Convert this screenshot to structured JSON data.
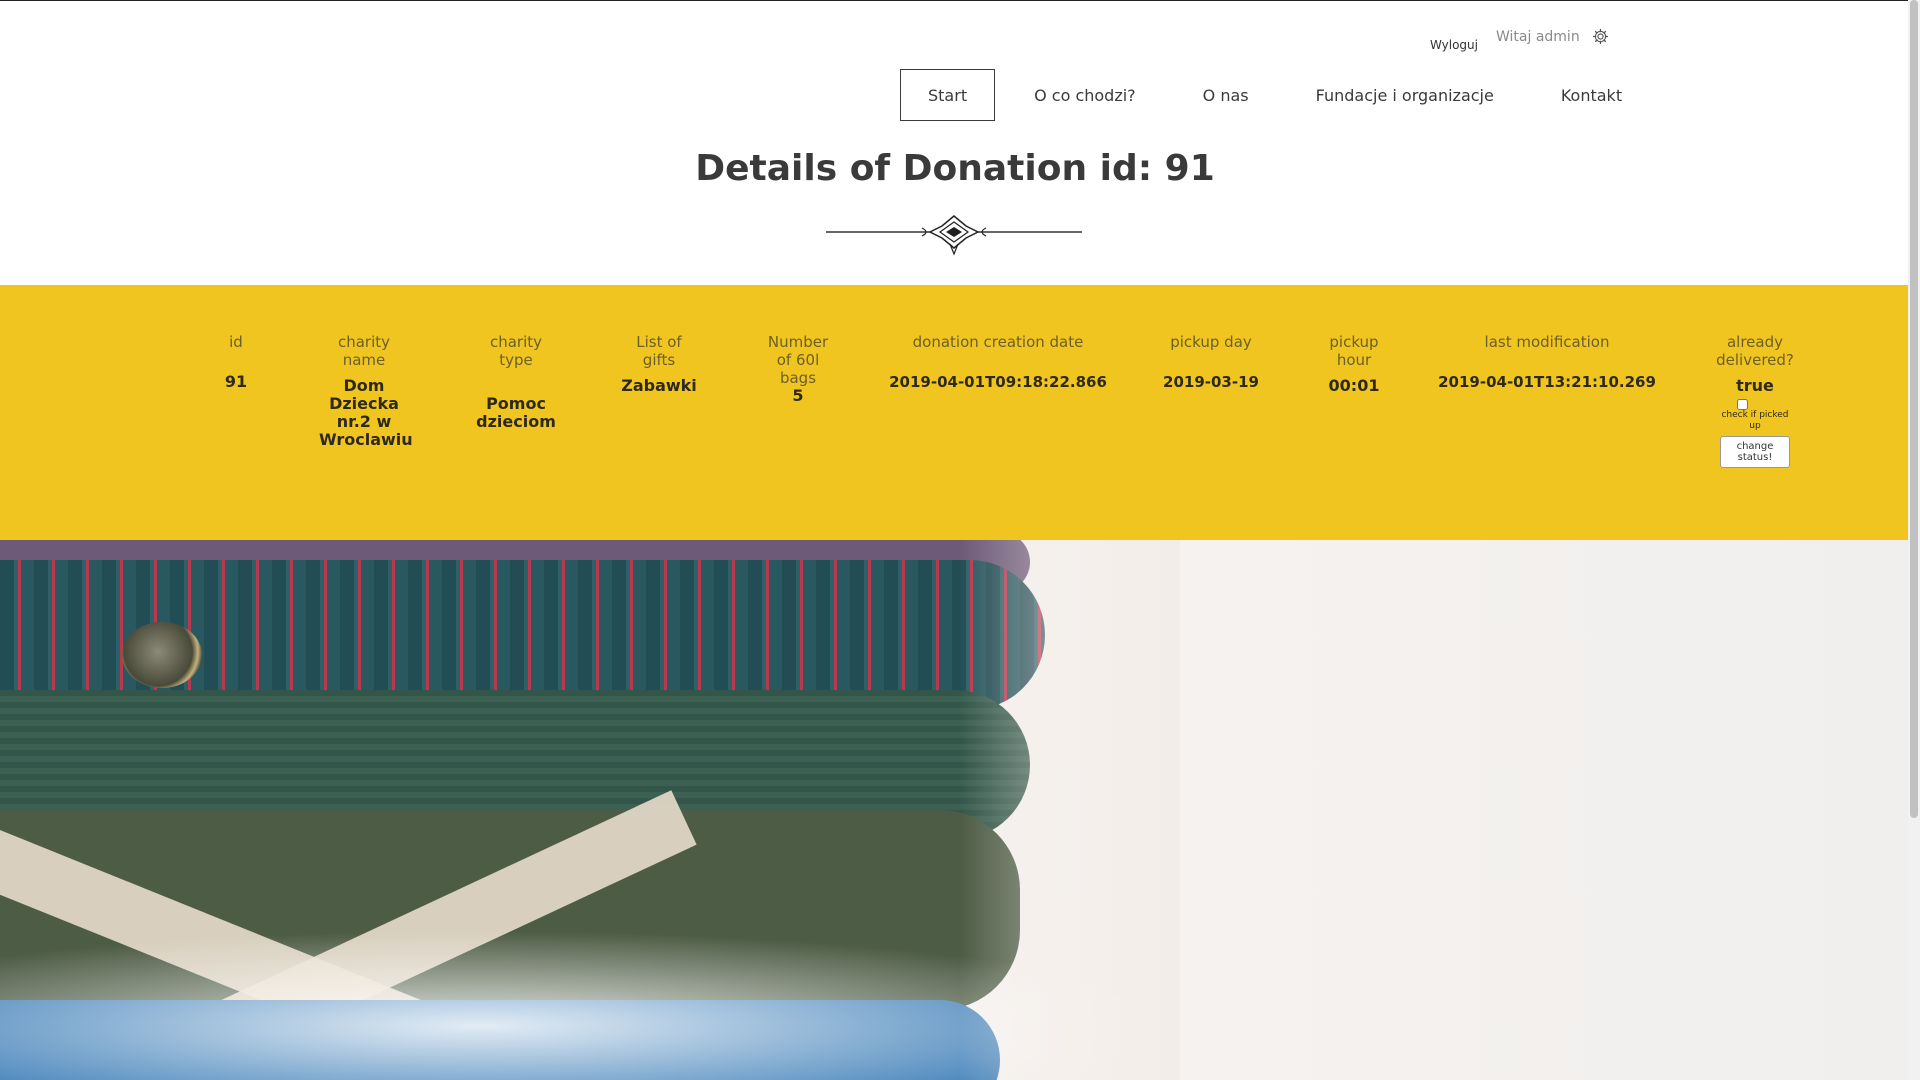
{
  "header": {
    "logout_label": "Wyloguj",
    "welcome_text": "Witaj admin",
    "settings_icon": "gear-icon"
  },
  "nav": {
    "items": [
      "Start",
      "O co chodzi?",
      "O nas",
      "Fundacje i organizacje",
      "Kontakt"
    ],
    "active_index": 0
  },
  "page": {
    "title": "Details of Donation id: 91"
  },
  "band_color": "#f1c520",
  "donation_table": {
    "columns": [
      {
        "header": "id",
        "value": "91"
      },
      {
        "header": "charity name",
        "value": "Dom Dziecka nr.2 w Wroclawiu"
      },
      {
        "header": "charity type",
        "value": "Pomoc dzieciom"
      },
      {
        "header": "List of gifts",
        "value": "Zabawki"
      },
      {
        "header": "Number of 60l bags",
        "value": "5"
      },
      {
        "header": "donation creation date",
        "value": "2019-04-01T09:18:22.866"
      },
      {
        "header": "pickup day",
        "value": "2019-03-19"
      },
      {
        "header": "pickup hour",
        "value": "00:01"
      },
      {
        "header": "last modification",
        "value": "2019-04-01T13:21:10.269"
      },
      {
        "header": "already delivered?",
        "value": "true"
      }
    ],
    "checkbox_label": "check if picked up",
    "change_status_label": "change status!"
  }
}
